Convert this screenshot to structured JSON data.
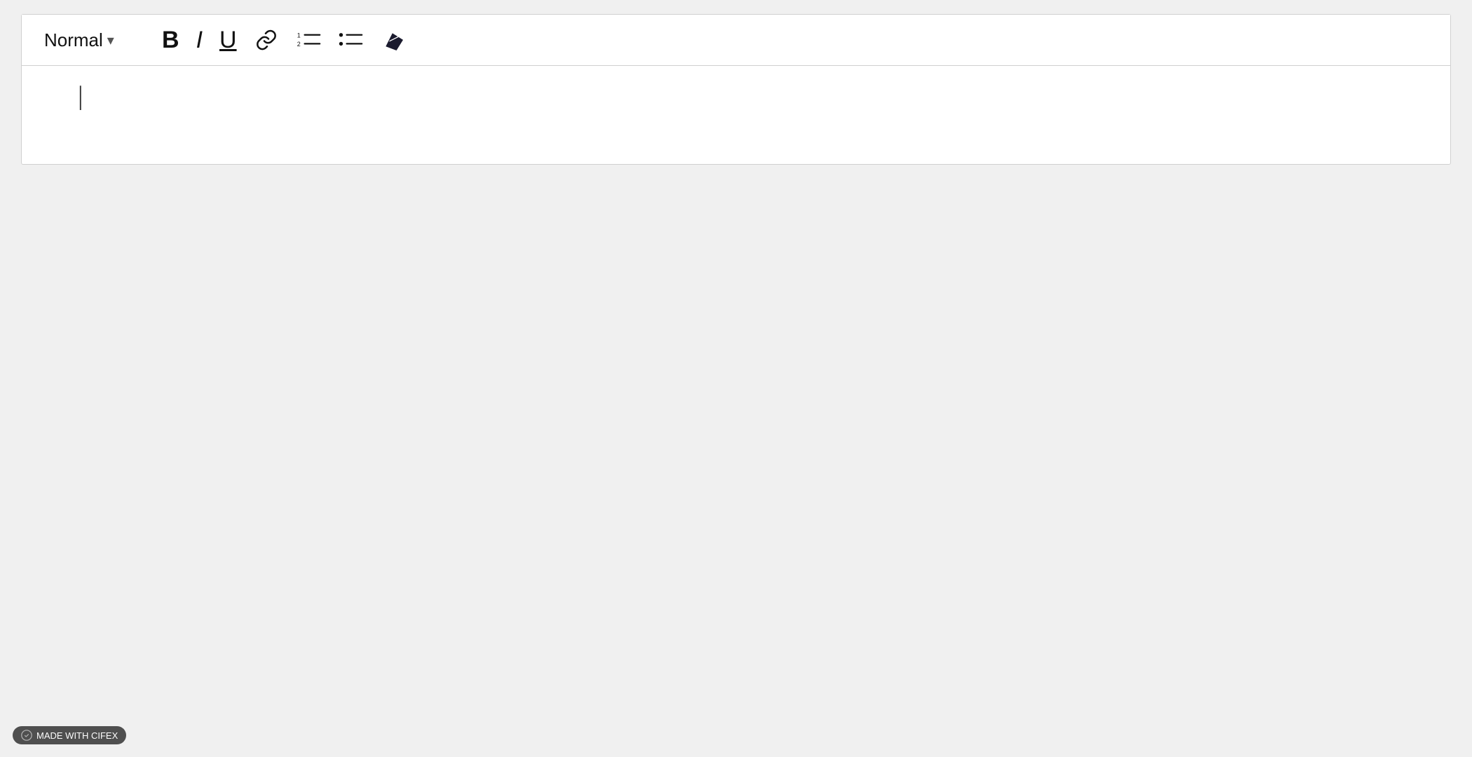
{
  "toolbar": {
    "style_label": "Normal",
    "style_arrow": "▾",
    "bold_label": "B",
    "italic_label": "I",
    "underline_label": "U",
    "buttons": [
      {
        "name": "bold",
        "label": "B"
      },
      {
        "name": "italic",
        "label": "I"
      },
      {
        "name": "underline",
        "label": "U"
      }
    ]
  },
  "editor": {
    "placeholder": ""
  },
  "badge": {
    "label": "MADE WITH CIFEX"
  }
}
